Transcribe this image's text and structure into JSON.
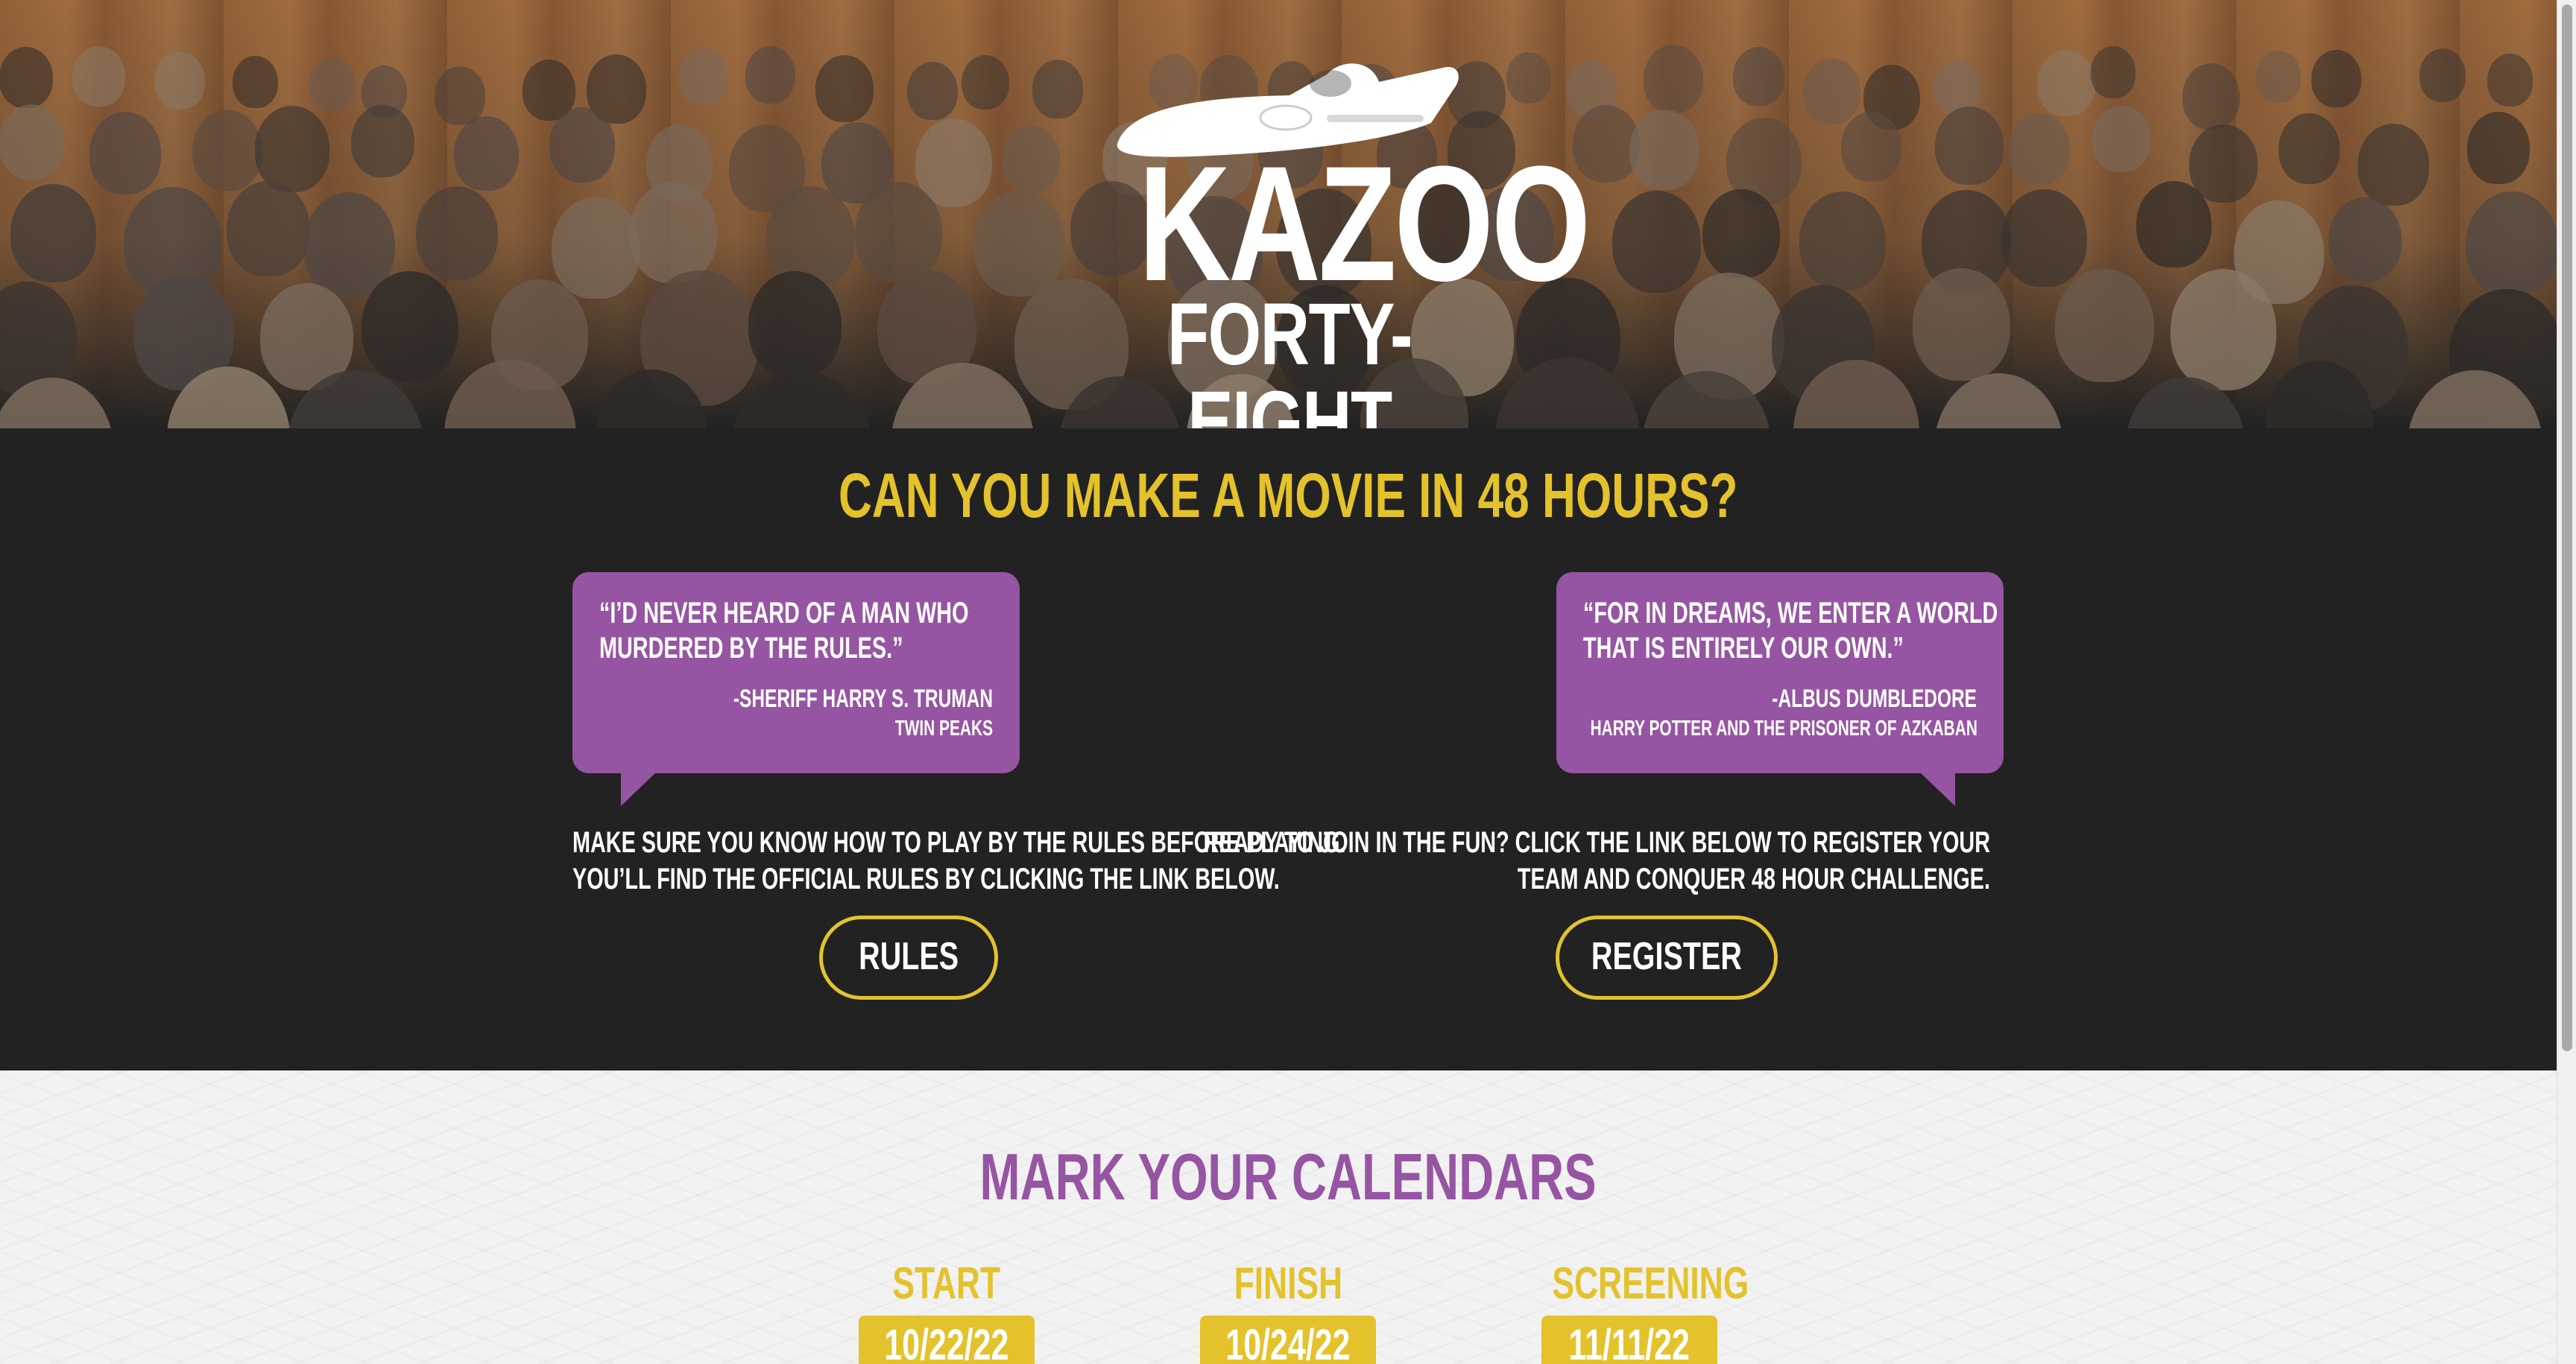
{
  "hero": {
    "logo_alt": "kazoo-logo",
    "logo_line1": "KAZOO",
    "logo_line2": "FORTY-EIGHT"
  },
  "intro": {
    "headline": "CAN YOU MAKE A MOVIE IN 48 HOURS?"
  },
  "quotes": [
    {
      "text_line1": "“I’D NEVER HEARD OF A MAN WHO",
      "text_line2": "MURDERED BY THE RULES.”",
      "author": "-SHERIFF HARRY S. TRUMAN",
      "source": "TWIN PEAKS"
    },
    {
      "text_line1": "“FOR IN DREAMS, WE ENTER A WORLD",
      "text_line2": "THAT IS ENTIRELY OUR OWN.”",
      "author": "-ALBUS DUMBLEDORE",
      "source": "HARRY POTTER AND THE PRISONER OF AZKABAN"
    }
  ],
  "rules": {
    "line1": "MAKE SURE YOU KNOW HOW TO PLAY BY THE RULES BEFORE PLAYING.",
    "line2": "YOU’LL FIND THE OFFICIAL RULES BY CLICKING THE LINK BELOW.",
    "button_label": "RULES"
  },
  "register": {
    "line1": "READY TO JOIN IN THE FUN? CLICK THE LINK BELOW TO REGISTER YOUR",
    "line2": "TEAM AND CONQUER 48 HOUR CHALLENGE.",
    "button_label": "REGISTER"
  },
  "calendar": {
    "title": "MARK YOUR CALENDARS",
    "dates": [
      {
        "label": "START",
        "date": "10/22/22"
      },
      {
        "label": "FINISH",
        "date": "10/24/22"
      },
      {
        "label": "SCREENING",
        "date": "11/11/22"
      }
    ]
  },
  "colors": {
    "accent_yellow": "#e3c22c",
    "accent_purple": "#9655a2",
    "dark_bg": "#222222",
    "light_bg": "#f2f2f2"
  }
}
